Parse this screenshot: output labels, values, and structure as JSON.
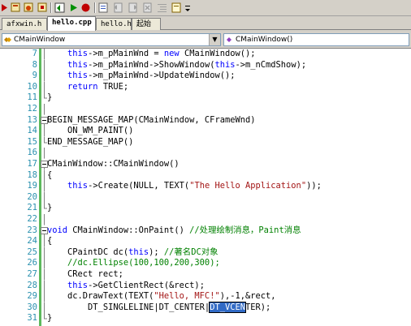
{
  "toolbar": {
    "icons": [
      "build-icon",
      "compile-icon",
      "rebuild-icon",
      "stop-icon",
      "run-icon",
      "debug-icon",
      "step-icon",
      "bookmark-icon",
      "prev-bookmark-icon",
      "next-bookmark-icon",
      "clear-bookmark-icon",
      "indent-icon",
      "more-icon"
    ]
  },
  "tabs": [
    {
      "label": "afxwin.h",
      "active": false
    },
    {
      "label": "hello.cpp",
      "active": true
    },
    {
      "label": "hello.h",
      "active": false
    },
    {
      "label": "起始页",
      "active": false
    }
  ],
  "class_combo": {
    "value": "CMainWindow"
  },
  "member_combo": {
    "value": "CMainWindow()"
  },
  "lines": [
    {
      "n": "7",
      "fold": "none"
    },
    {
      "n": "8",
      "fold": "none"
    },
    {
      "n": "9",
      "fold": "none"
    },
    {
      "n": "10",
      "fold": "none"
    },
    {
      "n": "11",
      "fold": "end"
    },
    {
      "n": "12",
      "fold": "none"
    },
    {
      "n": "13",
      "fold": "minus"
    },
    {
      "n": "14",
      "fold": "none"
    },
    {
      "n": "15",
      "fold": "end"
    },
    {
      "n": "16",
      "fold": "none"
    },
    {
      "n": "17",
      "fold": "minus"
    },
    {
      "n": "18",
      "fold": "none"
    },
    {
      "n": "19",
      "fold": "none"
    },
    {
      "n": "20",
      "fold": "none"
    },
    {
      "n": "21",
      "fold": "end"
    },
    {
      "n": "22",
      "fold": "none"
    },
    {
      "n": "23",
      "fold": "minus"
    },
    {
      "n": "24",
      "fold": "none"
    },
    {
      "n": "25",
      "fold": "none"
    },
    {
      "n": "26",
      "fold": "none"
    },
    {
      "n": "27",
      "fold": "none"
    },
    {
      "n": "28",
      "fold": "none"
    },
    {
      "n": "29",
      "fold": "none"
    },
    {
      "n": "30",
      "fold": "none"
    },
    {
      "n": "31",
      "fold": "end"
    }
  ],
  "code": {
    "l7": [
      {
        "t": "    "
      },
      {
        "t": "this",
        "c": "kw"
      },
      {
        "t": "->m_pMainWnd = "
      },
      {
        "t": "new",
        "c": "kw"
      },
      {
        "t": " CMainWindow();"
      }
    ],
    "l8": [
      {
        "t": "    "
      },
      {
        "t": "this",
        "c": "kw"
      },
      {
        "t": "->m_pMainWnd->ShowWindow("
      },
      {
        "t": "this",
        "c": "kw"
      },
      {
        "t": "->m_nCmdShow);"
      }
    ],
    "l9": [
      {
        "t": "    "
      },
      {
        "t": "this",
        "c": "kw"
      },
      {
        "t": "->m_pMainWnd->UpdateWindow();"
      }
    ],
    "l10": [
      {
        "t": "    "
      },
      {
        "t": "return",
        "c": "kw"
      },
      {
        "t": " TRUE;"
      }
    ],
    "l11": [
      {
        "t": "}"
      }
    ],
    "l12": [
      {
        "t": ""
      }
    ],
    "l13": [
      {
        "t": "BEGIN_MESSAGE_MAP(CMainWindow, CFrameWnd)"
      }
    ],
    "l14": [
      {
        "t": "    ON_WM_PAINT()"
      }
    ],
    "l15": [
      {
        "t": "END_MESSAGE_MAP()"
      }
    ],
    "l16": [
      {
        "t": ""
      }
    ],
    "l17": [
      {
        "t": "CMainWindow::CMainWindow()"
      }
    ],
    "l18": [
      {
        "t": "{"
      }
    ],
    "l19": [
      {
        "t": "    "
      },
      {
        "t": "this",
        "c": "kw"
      },
      {
        "t": "->Create(NULL, TEXT("
      },
      {
        "t": "\"The Hello Application\"",
        "c": "str"
      },
      {
        "t": "));"
      }
    ],
    "l20": [
      {
        "t": ""
      }
    ],
    "l21": [
      {
        "t": "}"
      }
    ],
    "l22": [
      {
        "t": ""
      }
    ],
    "l23": [
      {
        "t": "void",
        "c": "kw"
      },
      {
        "t": " CMainWindow::OnPaint() "
      },
      {
        "t": "//处理绘制消息，Paint消息",
        "c": "cmt"
      }
    ],
    "l24": [
      {
        "t": "{"
      }
    ],
    "l25": [
      {
        "t": "    CPaintDC dc("
      },
      {
        "t": "this",
        "c": "kw"
      },
      {
        "t": "); "
      },
      {
        "t": "//著名DC对象",
        "c": "cmt"
      }
    ],
    "l26": [
      {
        "t": "    "
      },
      {
        "t": "//dc.Ellipse(100,100,200,300);",
        "c": "cmt"
      }
    ],
    "l27": [
      {
        "t": "    CRect rect;"
      }
    ],
    "l28": [
      {
        "t": "    "
      },
      {
        "t": "this",
        "c": "kw"
      },
      {
        "t": "->GetClientRect(&rect);"
      }
    ],
    "l29": [
      {
        "t": "    dc.DrawText(TEXT("
      },
      {
        "t": "\"Hello, MFC!\"",
        "c": "str"
      },
      {
        "t": "),-1,&rect,"
      }
    ],
    "l30": [
      {
        "t": "        DT_SINGLELINE|DT_CENTER|"
      },
      {
        "t": "DT_VCEN",
        "c": "sel"
      },
      {
        "t": "TER);"
      }
    ],
    "l31": [
      {
        "t": "}"
      }
    ]
  },
  "colors": {
    "keyword": "#0000ff",
    "string": "#a31515",
    "comment": "#008000",
    "line_number": "#2b91af",
    "selection": "#316ac5",
    "change_bar": "#5cb85c"
  }
}
